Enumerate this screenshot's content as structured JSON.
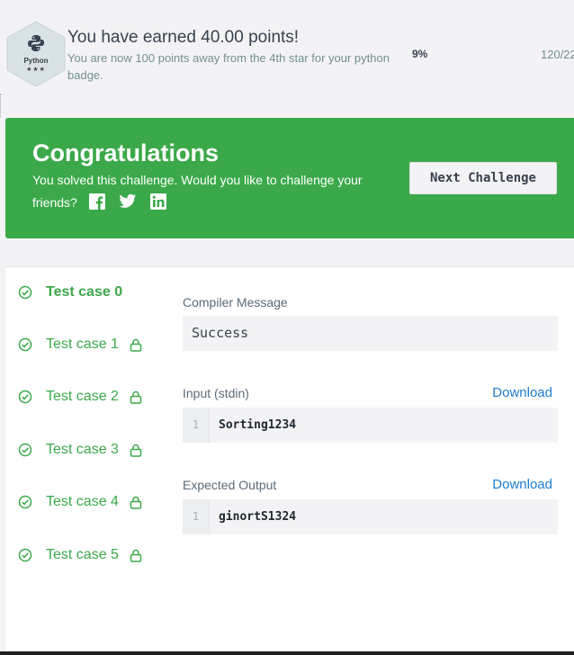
{
  "badge": {
    "language": "Python",
    "stars": "★★★",
    "earned_text": "You have earned 40.00 points!",
    "away_text": "You are now 100 points away from the 4th star for your python badge.",
    "percent": "9%",
    "progress_count": "120/22"
  },
  "congrats": {
    "title": "Congratulations",
    "message": "You solved this challenge. Would you like to challenge your friends?",
    "share_icons": [
      "facebook-icon",
      "twitter-icon",
      "linkedin-icon"
    ],
    "next_button": "Next Challenge",
    "color": "#3ba94a"
  },
  "test_cases": [
    {
      "label": "Test case 0",
      "locked": false,
      "active": true
    },
    {
      "label": "Test case 1",
      "locked": true,
      "active": false
    },
    {
      "label": "Test case 2",
      "locked": true,
      "active": false
    },
    {
      "label": "Test case 3",
      "locked": true,
      "active": false
    },
    {
      "label": "Test case 4",
      "locked": true,
      "active": false
    },
    {
      "label": "Test case 5",
      "locked": true,
      "active": false
    }
  ],
  "result": {
    "compiler_label": "Compiler Message",
    "compiler_message": "Success",
    "input_label": "Input (stdin)",
    "input_download": "Download",
    "input_line_no": "1",
    "input_value": "Sorting1234",
    "output_label": "Expected Output",
    "output_download": "Download",
    "output_line_no": "1",
    "output_value": "ginortS1324"
  }
}
